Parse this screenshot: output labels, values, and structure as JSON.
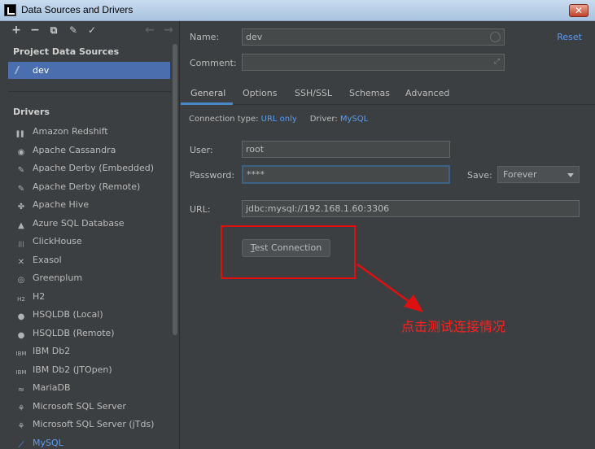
{
  "window": {
    "title": "Data Sources and Drivers",
    "close_label": "✕"
  },
  "left": {
    "toolbar": {
      "add": "+",
      "remove": "−",
      "duplicate": "⧉",
      "edit": "✎",
      "apply": "✓",
      "back": "←",
      "forward": "→"
    },
    "project_header": "Project Data Sources",
    "data_sources": [
      {
        "name": "dev"
      }
    ],
    "drivers_header": "Drivers",
    "drivers": [
      {
        "name": "Amazon Redshift",
        "icon": "redshift-icon",
        "glyph": "▌▌"
      },
      {
        "name": "Apache Cassandra",
        "icon": "cassandra-icon",
        "glyph": "◉"
      },
      {
        "name": "Apache Derby (Embedded)",
        "icon": "derby-icon",
        "glyph": "✎"
      },
      {
        "name": "Apache Derby (Remote)",
        "icon": "derby-icon",
        "glyph": "✎"
      },
      {
        "name": "Apache Hive",
        "icon": "hive-icon",
        "glyph": "✤"
      },
      {
        "name": "Azure SQL Database",
        "icon": "azure-icon",
        "glyph": "▲"
      },
      {
        "name": "ClickHouse",
        "icon": "clickhouse-icon",
        "glyph": "|||"
      },
      {
        "name": "Exasol",
        "icon": "exasol-icon",
        "glyph": "✕"
      },
      {
        "name": "Greenplum",
        "icon": "greenplum-icon",
        "glyph": "◎"
      },
      {
        "name": "H2",
        "icon": "h2-icon",
        "glyph": "H2"
      },
      {
        "name": "HSQLDB (Local)",
        "icon": "hsqldb-icon",
        "glyph": "●"
      },
      {
        "name": "HSQLDB (Remote)",
        "icon": "hsqldb-icon",
        "glyph": "●"
      },
      {
        "name": "IBM Db2",
        "icon": "ibm-icon",
        "glyph": "IBM"
      },
      {
        "name": "IBM Db2 (JTOpen)",
        "icon": "ibm-icon",
        "glyph": "IBM"
      },
      {
        "name": "MariaDB",
        "icon": "mariadb-icon",
        "glyph": "≈"
      },
      {
        "name": "Microsoft SQL Server",
        "icon": "mssql-icon",
        "glyph": "⚘"
      },
      {
        "name": "Microsoft SQL Server (jTds)",
        "icon": "mssql-icon",
        "glyph": "⚘"
      },
      {
        "name": "MySQL",
        "icon": "mysql-icon",
        "glyph": "⟋"
      }
    ]
  },
  "form": {
    "name_label": "Name:",
    "name_value": "dev",
    "reset_label": "Reset",
    "comment_label": "Comment:",
    "comment_value": "",
    "tabs": [
      "General",
      "Options",
      "SSH/SSL",
      "Schemas",
      "Advanced"
    ],
    "connection_type_label": "Connection type:",
    "connection_type_value": "URL only",
    "driver_label": "Driver:",
    "driver_value": "MySQL",
    "user_label": "User:",
    "user_value": "root",
    "password_label": "Password:",
    "password_value": "****",
    "save_label": "Save:",
    "save_value": "Forever",
    "url_label": "URL:",
    "url_value": "jdbc:mysql://192.168.1.60:3306",
    "test_button_mnemonic": "T",
    "test_button_rest": "est Connection"
  },
  "annotation": {
    "text": "点击测试连接情况",
    "color": "#ff2020"
  }
}
